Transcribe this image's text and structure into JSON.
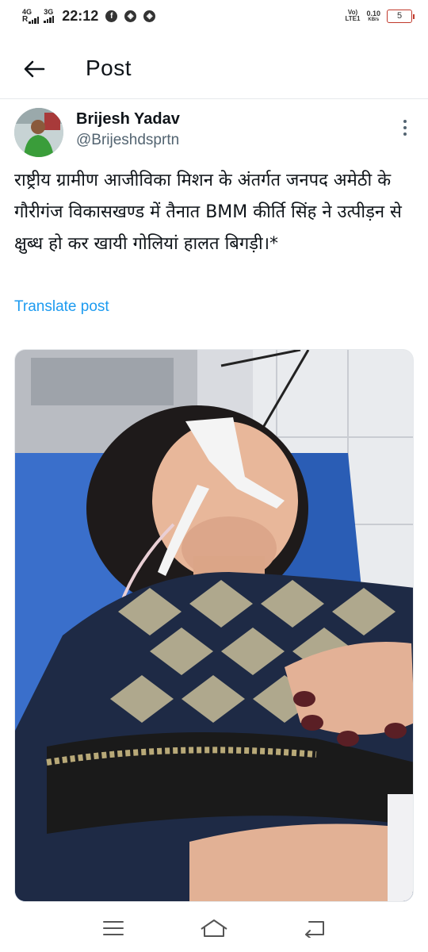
{
  "status_bar": {
    "network1": "4G",
    "network1_sub": "R",
    "network2": "3G",
    "time": "22:12",
    "volte": "VoLTE1",
    "speed_value": "0.10",
    "speed_unit": "KB/s",
    "battery": "5",
    "icons": [
      "facebook-icon",
      "vpn-icon",
      "vpn-icon"
    ]
  },
  "header": {
    "title": "Post"
  },
  "author": {
    "name": "Brijesh Yadav",
    "handle": "@Brijeshdsprtn"
  },
  "post": {
    "text": "राष्ट्रीय ग्रामीण आजीविका मिशन के अंतर्गत जनपद अमेठी के गौरीगंज विकासखण्ड में तैनात BMM कीर्ति सिंह ने उत्पीड़न से क्षुब्ध हो कर खायी गोलियां हालत बिगड़ी।*",
    "translate_label": "Translate post"
  },
  "colors": {
    "link": "#1d9bf0",
    "secondary_text": "#536471",
    "primary_text": "#0f1419"
  },
  "nav": {
    "icons": [
      "menu-icon",
      "home-icon",
      "back-icon"
    ]
  }
}
